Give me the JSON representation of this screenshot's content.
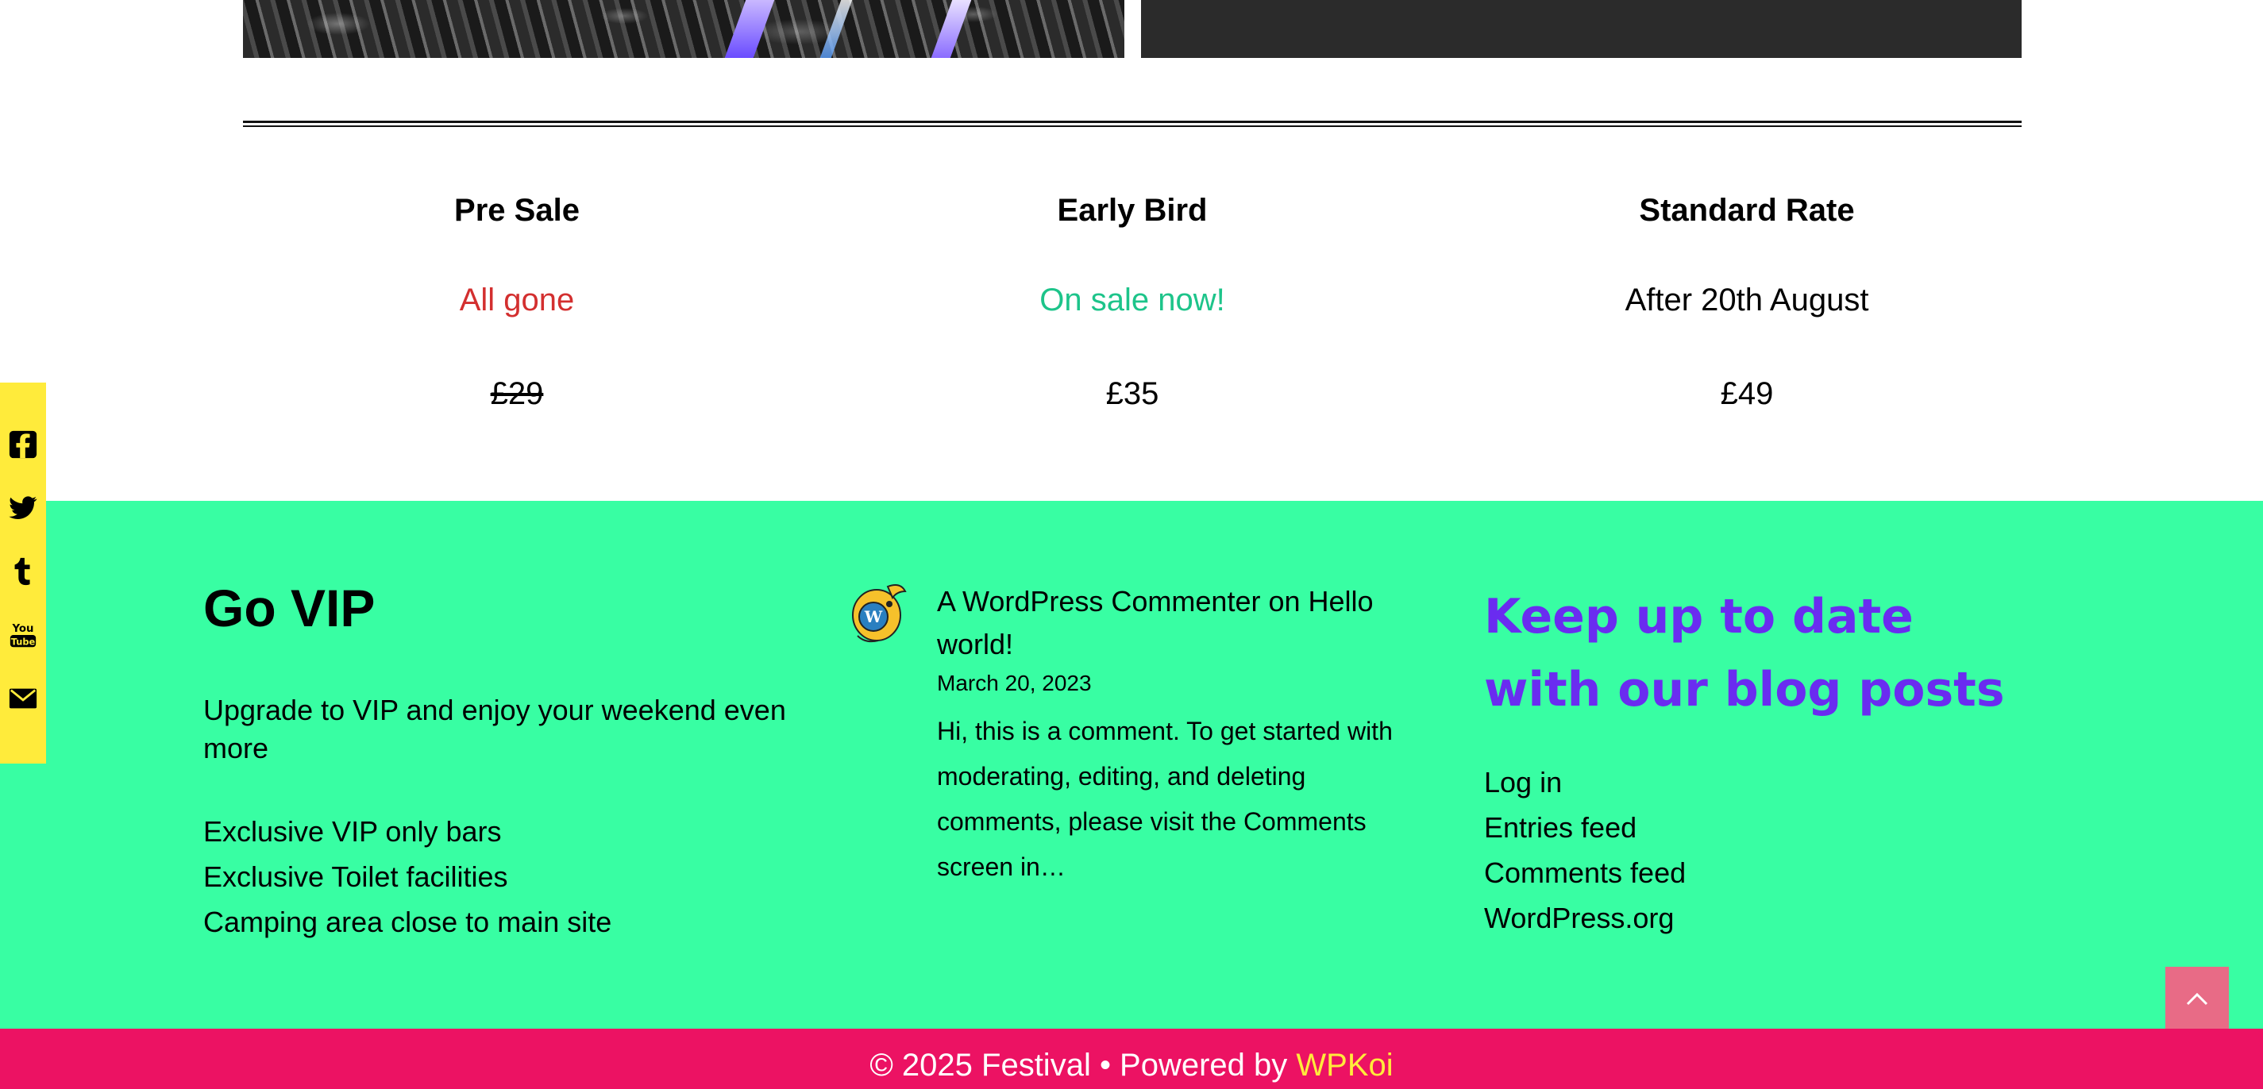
{
  "pricing": {
    "tiers": [
      {
        "name": "Pre Sale",
        "status": "All gone",
        "status_color": "#d32f2f",
        "price": "£29",
        "price_struck": true
      },
      {
        "name": "Early Bird",
        "status": "On sale now!",
        "status_color": "#1dc48a",
        "price": "£35",
        "price_struck": false
      },
      {
        "name": "Standard Rate",
        "status": "After 20th August",
        "status_color": "#000000",
        "price": "£49",
        "price_struck": false
      }
    ]
  },
  "social": {
    "icons": [
      "facebook-icon",
      "twitter-icon",
      "tumblr-icon",
      "youtube-icon",
      "email-icon"
    ],
    "background": "#ffeb3b"
  },
  "vip": {
    "title": "Go VIP",
    "intro": "Upgrade to VIP and enjoy your weekend even more",
    "perks": [
      "Exclusive VIP only bars",
      "Exclusive Toilet facilities",
      "Camping area close to main site"
    ]
  },
  "comment": {
    "title": "A WordPress Commenter on Hello world!",
    "date": "March 20, 2023",
    "excerpt": "Hi, this is a comment. To get started with moderating, editing, and deleting comments, please visit the Comments screen in…"
  },
  "blog": {
    "title": "Keep up to date with our blog posts",
    "title_color": "#6a2cf0",
    "links": [
      "Log in",
      "Entries feed",
      "Comments feed",
      "WordPress.org"
    ]
  },
  "footer": {
    "copyright": "© 2025 Festival • Powered by ",
    "brand": "WPKoi",
    "brand_color": "#ffeb3b",
    "background": "#ec1263"
  },
  "colors": {
    "widgets_bg": "#38fea3",
    "scroll_top_bg": "#e86b86"
  }
}
